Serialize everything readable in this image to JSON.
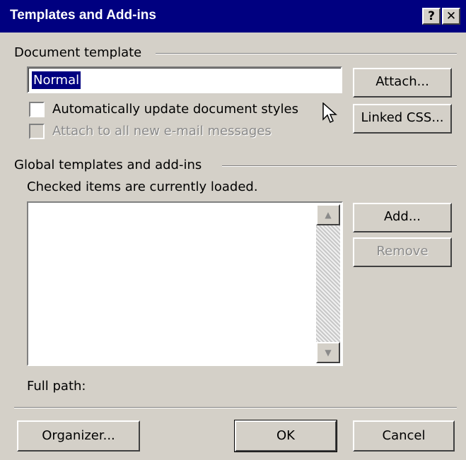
{
  "window": {
    "title": "Templates and Add-ins",
    "help_glyph": "?",
    "close_glyph": "✕"
  },
  "document_template": {
    "group_label": "Document template",
    "template_value": "Normal",
    "attach_button": "Attach...",
    "linked_css_button": "Linked CSS...",
    "auto_update_label": "Automatically update document styles",
    "auto_update_checked": false,
    "attach_email_label": "Attach to all new e-mail messages",
    "attach_email_checked": false,
    "attach_email_enabled": false
  },
  "global_templates": {
    "group_label": "Global templates and add-ins",
    "hint": "Checked items are currently loaded.",
    "items": [],
    "add_button": "Add...",
    "remove_button": "Remove",
    "remove_enabled": false,
    "full_path_label": "Full path:",
    "scroll_up_glyph": "▲",
    "scroll_down_glyph": "▼"
  },
  "footer": {
    "organizer_button": "Organizer...",
    "ok_button": "OK",
    "cancel_button": "Cancel"
  },
  "colors": {
    "titlebar": "#000080",
    "face": "#d4d0c8",
    "selection": "#000080"
  },
  "icons": [
    "help-icon",
    "close-icon",
    "scroll-up-icon",
    "scroll-down-icon",
    "mouse-cursor-icon"
  ]
}
